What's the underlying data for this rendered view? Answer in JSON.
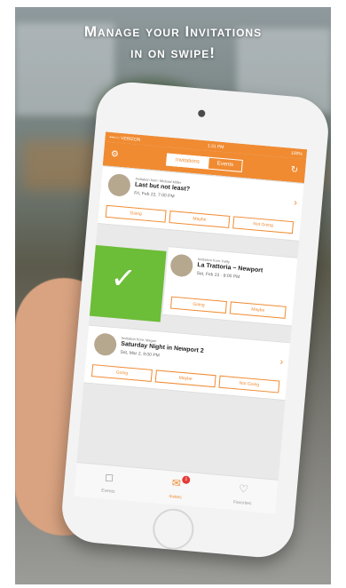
{
  "headline": [
    "Manage your Invitations",
    "in on swipe!"
  ],
  "status": {
    "carrier": "•••○○ VERIZON",
    "time": "1:31 PM",
    "battery": "100%"
  },
  "topbar": {
    "tabs": [
      "Invitations",
      "Events"
    ],
    "left_icon": "settings-icon",
    "right_icon": "refresh-icon"
  },
  "cards": [
    {
      "org": "Invitation from: Michael Miller",
      "title": "Last but not least?",
      "subtitle": "Fri, Feb 22, 7:00 PM",
      "actions": [
        "Going",
        "Maybe",
        "Not Going"
      ]
    },
    {
      "org": "Invitation from: Kelly",
      "title": "La Trattoria ~ Newport",
      "subtitle": "Sat, Feb 23 · 8:00 PM",
      "actions": [
        "Going",
        "Maybe"
      ]
    },
    {
      "org": "Invitation from: Megan",
      "title": "Saturday Night in Newport 2",
      "subtitle": "Sat, Mar 2, 9:00 PM",
      "actions": [
        "Going",
        "Maybe",
        "Not Going"
      ]
    }
  ],
  "swipe": {
    "icon": "✓"
  },
  "tabs": [
    {
      "label": "Events",
      "icon": "◻"
    },
    {
      "label": "Invites",
      "icon": "✉",
      "badge": "1"
    },
    {
      "label": "Favorites",
      "icon": "♡"
    }
  ],
  "colors": {
    "accent": "#f08b32",
    "green": "#6cbd38"
  }
}
